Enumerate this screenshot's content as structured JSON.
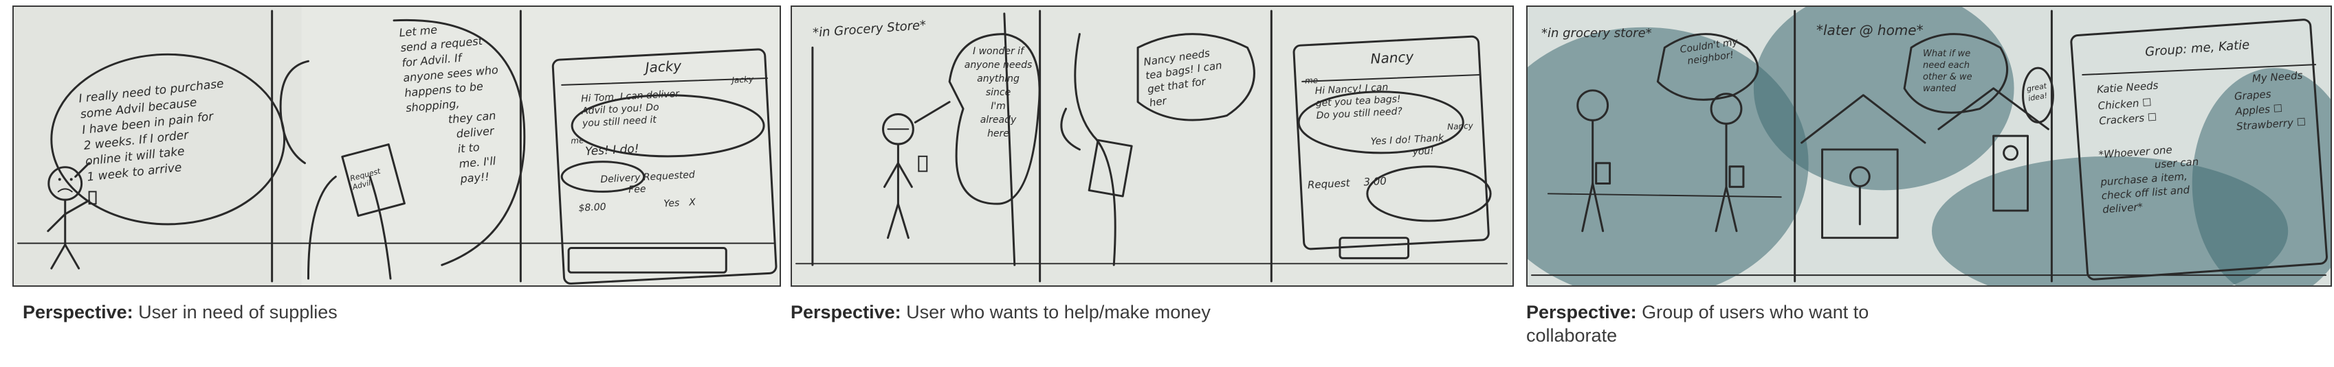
{
  "storyboards": [
    {
      "caption_label": "Perspective:",
      "caption_text": "User in need of supplies",
      "frames": [
        {
          "speech": [
            "I really need to purchase",
            "some Advil because",
            "I have been in pain for",
            "2 weeks. If I order",
            "online it will take",
            "1 week to arrive"
          ]
        },
        {
          "speech": [
            "Let me",
            "send a request",
            "for Advil. If",
            "anyone sees who",
            "happens to be",
            "shopping,",
            "they can",
            "deliver",
            "it to",
            "me. I'll",
            "pay!!"
          ],
          "phone_label": "Request Advil"
        },
        {
          "phone_title": "Jacky",
          "msg_from": "Jacky",
          "msg_in": [
            "Hi Tom, I can deliver",
            "Advil to you! Do",
            "you still need it"
          ],
          "msg_me": "me",
          "msg_out": "Yes! I do!",
          "footer": [
            "Delivery Requested",
            "Fee"
          ],
          "price": "$8.00",
          "yes": "Yes",
          "no": "X"
        }
      ]
    },
    {
      "caption_label": "Perspective:",
      "caption_text": "User who wants to help/make money",
      "frames": [
        {
          "scene_note": "*in Grocery Store*",
          "thought": [
            "I wonder if",
            "anyone needs",
            "anything",
            "since",
            "I'm",
            "already",
            "here"
          ]
        },
        {
          "speech": [
            "Nancy needs",
            "tea bags! I can",
            "get that for",
            "her"
          ]
        },
        {
          "phone_title": "Nancy",
          "msg_me": "me",
          "msg_in": [
            "Hi Nancy! I can",
            "get you tea bags!",
            "Do you still need?"
          ],
          "msg_from": "Nancy",
          "msg_out": [
            "Yes I do! Thank",
            "you!"
          ],
          "footer": "Request",
          "price": "3.00"
        }
      ]
    },
    {
      "caption_label": "Perspective:",
      "caption_text": "Group of users who want to collaborate",
      "frames": [
        {
          "scene_note": "*in grocery store*",
          "thought": [
            "Couldn't my",
            "neighbor!"
          ]
        },
        {
          "scene_note": "*later @ home*",
          "thought": [
            "What if we",
            "need each",
            "other & we",
            "wanted"
          ],
          "side_note": [
            "great",
            "idea!"
          ]
        },
        {
          "phone_title": "Group: me, Katie",
          "col_left": "Katie Needs",
          "col_right": "My Needs",
          "left_items": [
            "Chicken",
            "Crackers"
          ],
          "right_items": [
            "Grapes",
            "Apples",
            "Strawberry"
          ],
          "footnote": [
            "*Whoever one",
            "user can",
            "purchase a item,",
            "check off list and",
            "deliver*"
          ]
        }
      ]
    }
  ]
}
